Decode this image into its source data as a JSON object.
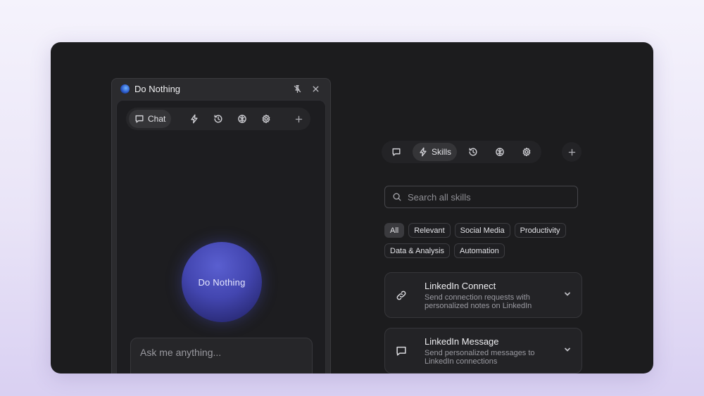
{
  "chat_window": {
    "title": "Do Nothing",
    "tabs": [
      {
        "icon": "chat-icon",
        "label": "Chat"
      },
      {
        "icon": "bolt-icon",
        "label": ""
      },
      {
        "icon": "history-icon",
        "label": ""
      },
      {
        "icon": "brain-icon",
        "label": ""
      },
      {
        "icon": "gear-icon",
        "label": ""
      }
    ],
    "orb_label": "Do Nothing",
    "input_placeholder": "Ask me anything..."
  },
  "skills_panel": {
    "active_tab_label": "Skills",
    "search_placeholder": "Search all skills",
    "filters": [
      "All",
      "Relevant",
      "Social Media",
      "Productivity",
      "Data & Analysis",
      "Automation"
    ],
    "active_filter": "All",
    "skills": [
      {
        "title": "LinkedIn Connect",
        "description": "Send connection requests with personalized notes on LinkedIn",
        "icon": "link-icon"
      },
      {
        "title": "LinkedIn Message",
        "description": "Send personalized messages to LinkedIn connections",
        "icon": "message-icon"
      }
    ]
  },
  "colors": {
    "background": "#1c1c1e",
    "orb": "#4346b0",
    "page_gradient_end": "#d9d0f2"
  }
}
